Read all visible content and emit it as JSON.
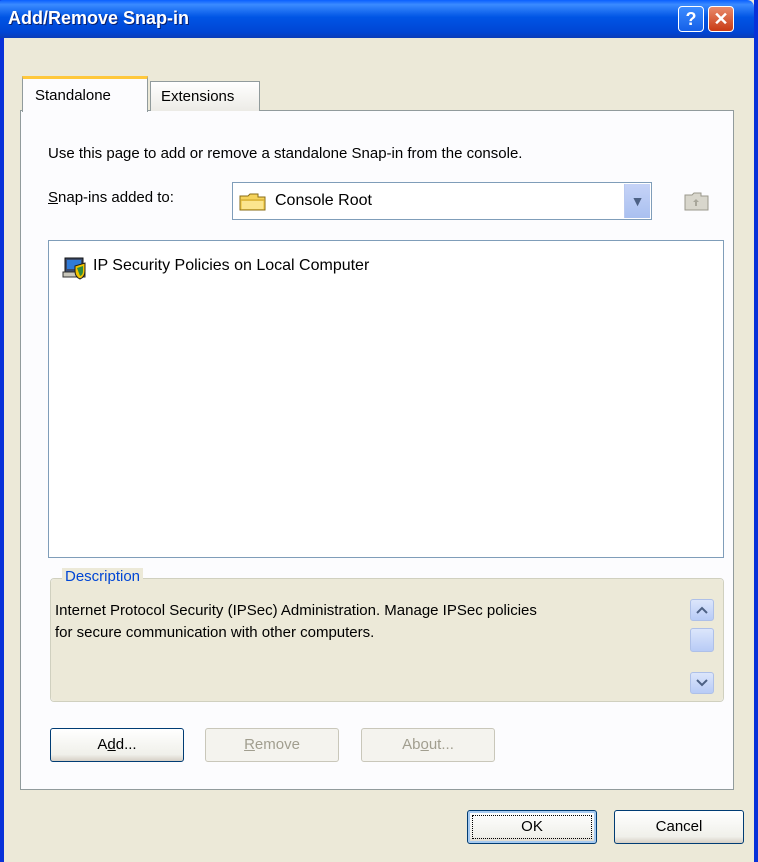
{
  "window": {
    "title": "Add/Remove Snap-in",
    "help_glyph": "?",
    "close_glyph": "✕"
  },
  "tabs": [
    {
      "label": "Standalone",
      "selected": true
    },
    {
      "label": "Extensions",
      "selected": false
    }
  ],
  "standalone": {
    "intro_text": "Use this page to add or remove a standalone Snap-in from the console.",
    "snapins_label_mnemonic": "S",
    "snapins_label_rest": "nap-ins added to:",
    "combo_value": "Console Root",
    "combo_arrow_glyph": "▼",
    "snapins": [
      {
        "label": "IP Security Policies on Local Computer",
        "icon": "ip-security-policy-icon"
      }
    ],
    "description": {
      "legend": "Description",
      "line1": "Internet Protocol Security (IPSec) Administration. Manage IPSec policies",
      "line2": "for secure communication with other computers."
    },
    "buttons": {
      "add_pre": "A",
      "add_mn": "d",
      "add_post": "d...",
      "remove_mn": "R",
      "remove_post": "emove",
      "about_pre": "Ab",
      "about_mn": "o",
      "about_post": "ut..."
    }
  },
  "footer": {
    "ok_label": "OK",
    "cancel_label": "Cancel"
  },
  "colors": {
    "titlebar": "#0055E5",
    "dialog_bg": "#ECE9D8",
    "tab_highlight": "#FFC83C",
    "legend_text": "#0046D5"
  }
}
